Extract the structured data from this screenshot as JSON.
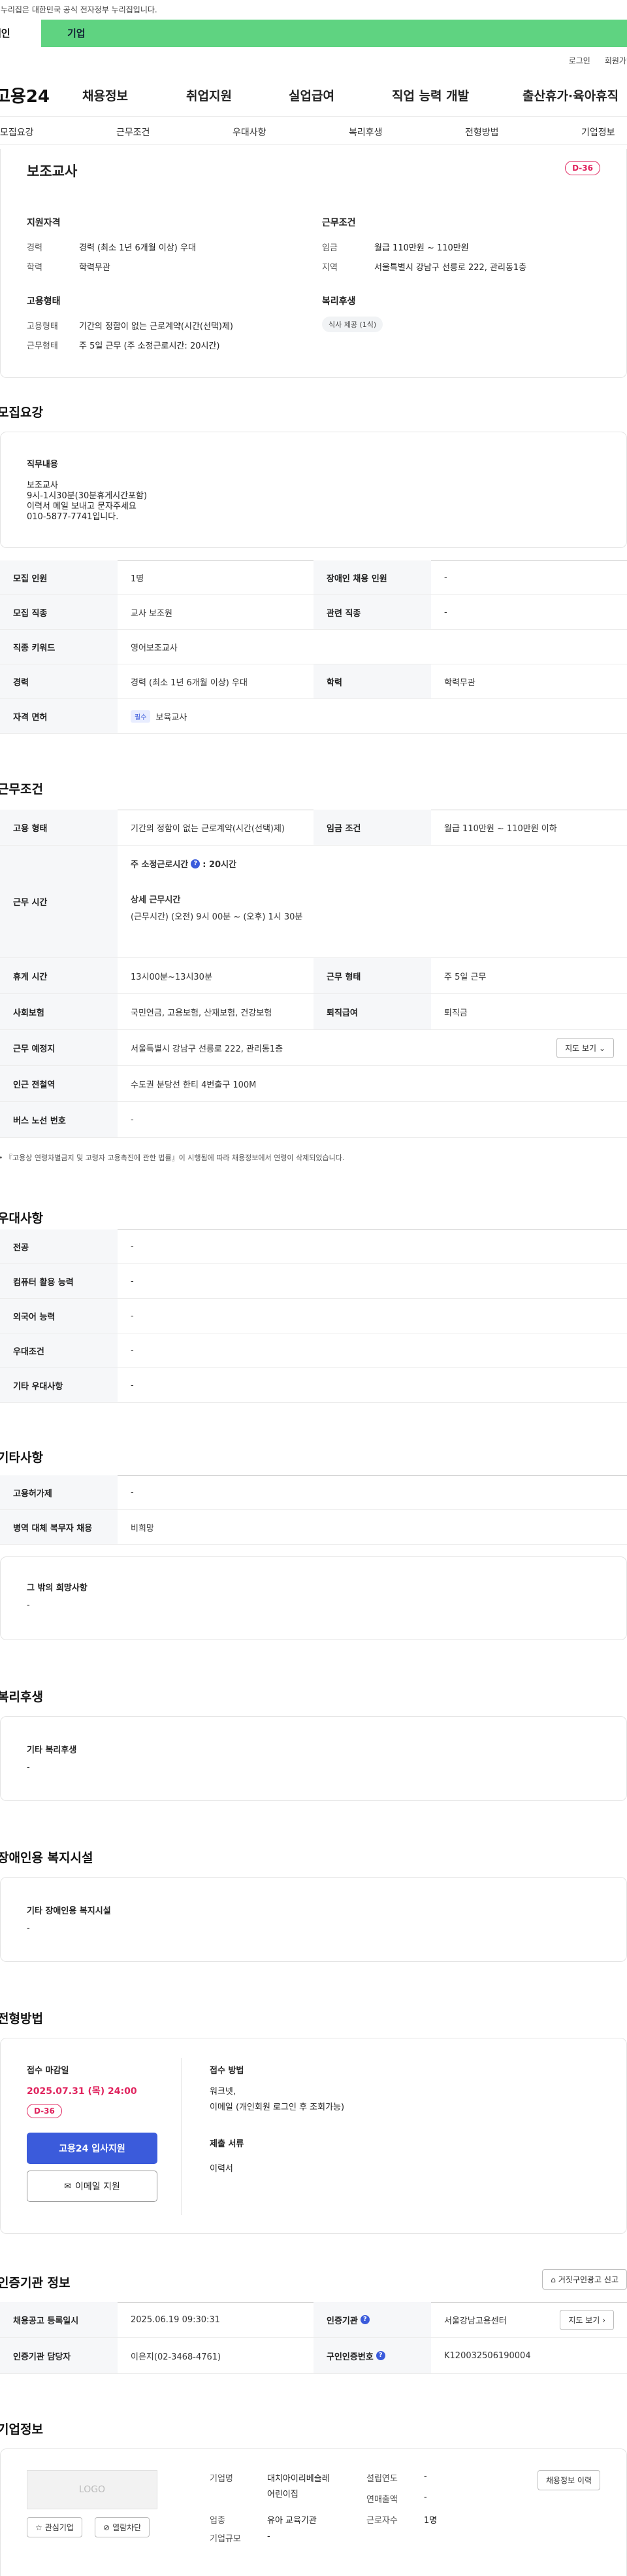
{
  "gov_notice": "이 누리집은 대한민국 공식 전자정부 누리집입니다.",
  "audience": {
    "individual": "개인",
    "corporate": "기업"
  },
  "util": {
    "login": "로그인",
    "signup": "회원가입"
  },
  "gnb": {
    "logo": "고용24",
    "items": [
      "채용정보",
      "취업지원",
      "실업급여",
      "직업 능력 개발",
      "출산휴가·육아휴직"
    ]
  },
  "tabs": [
    "모집요강",
    "근무조건",
    "우대사항",
    "복리후생",
    "전형방법",
    "기업정보"
  ],
  "summary": {
    "title": "보조교사",
    "dday": "D-36",
    "qual_title": "지원자격",
    "career_label": "경력",
    "career_value": "경력 (최소 1년 6개월 이상) 우대",
    "edu_label": "학력",
    "edu_value": "학력무관",
    "cond_title": "근무조건",
    "wage_label": "임금",
    "wage_value": "월급 110만원 ~ 110만원",
    "region_label": "지역",
    "region_value": "서울특별시 강남구 선릉로 222, 관리동1층",
    "emp_title": "고용형태",
    "emp_label": "고용형태",
    "emp_value": "기간의 정함이 없는 근로계약(시간(선택)제)",
    "work_label": "근무형태",
    "work_value": "주 5일 근무 (주 소정근로시간: 20시간)",
    "welfare_title": "복리후생",
    "welfare_chip": "식사 제공 (1식)"
  },
  "recruit": {
    "title": "모집요강",
    "job_title": "직무내용",
    "job_lines": [
      "보조교사",
      "9시-1시30분(30분휴게시간포함)",
      "이력서 메일 보내고 문자주세요",
      "010-5877-7741입니다."
    ],
    "rows": [
      {
        "k1": "모집 인원",
        "v1": "1명",
        "k2": "장애인 채용 인원",
        "v2": "-"
      },
      {
        "k1": "모집 직종",
        "v1": "교사 보조원",
        "k2": "관련 직종",
        "v2": "-"
      },
      {
        "k1": "직종 키워드",
        "v1": "영어보조교사",
        "k2": "",
        "v2": ""
      },
      {
        "k1": "경력",
        "v1": "경력 (최소 1년 6개월 이상) 우대",
        "k2": "학력",
        "v2": "학력무관"
      }
    ],
    "license_label": "자격 면허",
    "license_chip": "필수",
    "license_value": "보육교사"
  },
  "conditions": {
    "title": "근무조건",
    "type_label": "고용 형태",
    "type_value": "기간의 정함이 없는 근로계약(시간(선택)제)",
    "wage_label": "임금 조건",
    "wage_value": "월급 110만원 ~ 110만원 이하",
    "hours_label": "근무 시간",
    "hours_head": "주 소정근로시간",
    "hours_value": ": 20시간",
    "detail_head": "상세 근무시간",
    "detail_value": "(근무시간) (오전) 9시 00분 ~ (오후) 1시 30분",
    "rest_label": "휴게 시간",
    "rest_value": "13시00분~13시30분",
    "form_label": "근무 형태",
    "form_value": "주 5일 근무",
    "ins_label": "사회보험",
    "ins_value": "국민연금, 고용보험, 산재보험, 건강보험",
    "sev_label": "퇴직급여",
    "sev_value": "퇴직금",
    "place_label": "근무 예정지",
    "place_value": "서울특별시 강남구 선릉로 222, 관리동1층",
    "map_btn": "지도 보기",
    "subway_label": "인근 전철역",
    "subway_value": "수도권 분당선 한티 4번출구 100M",
    "bus_label": "버스 노선 번호",
    "bus_value": "-",
    "notice": "『고용상 연령차별금지 및 고령자 고용촉진에 관한 법률』이 시행됨에 따라 채용정보에서 연령이 삭제되었습니다."
  },
  "prefer": {
    "title": "우대사항",
    "rows": [
      {
        "k": "전공",
        "v": "-"
      },
      {
        "k": "컴퓨터 활용 능력",
        "v": "-"
      },
      {
        "k": "외국어 능력",
        "v": "-"
      },
      {
        "k": "우대조건",
        "v": "-"
      },
      {
        "k": "기타 우대사항",
        "v": "-"
      }
    ]
  },
  "etc": {
    "title": "기타사항",
    "rows": [
      {
        "k": "고용허가제",
        "v": "-"
      },
      {
        "k": "병역 대체 복무자 채용",
        "v": "비희망"
      }
    ],
    "other_title": "그 밖의 희망사항",
    "other_value": "-"
  },
  "welfare": {
    "title": "복리후생",
    "box_title": "기타 복리후생",
    "box_value": "-"
  },
  "disability": {
    "title": "장애인용 복지시설",
    "box_title": "기타 장애인용 복지시설",
    "box_value": "-"
  },
  "selection": {
    "title": "전형방법",
    "deadline_label": "접수 마감일",
    "deadline_value": "2025.07.31 (목) 24:00",
    "dday": "D-36",
    "apply_btn": "고용24 입사지원",
    "email_btn": "이메일 지원",
    "method_label": "접수 방법",
    "method_lines": [
      "워크넷,",
      "이메일 (개인회원 로그인 후 조회가능)"
    ],
    "docs_label": "제출 서류",
    "docs_value": "이력서"
  },
  "agency": {
    "title": "인증기관 정보",
    "report_btn": "거짓구인광고 신고",
    "reg_label": "채용공고 등록일시",
    "reg_value": "2025.06.19 09:30:31",
    "org_label": "인증기관",
    "org_value": "서울강남고용센터",
    "map_btn": "지도 보기",
    "staff_label": "인증기관 담당자",
    "staff_value": "이은지(02-3468-4761)",
    "no_label": "구인인증번호",
    "no_value": "K120032506190004"
  },
  "company": {
    "title": "기업정보",
    "logo_text": "LOGO",
    "fav_btn": "관심기업",
    "block_btn": "열람차단",
    "name_label": "기업명",
    "name_value_1": "대치아이리베슬레",
    "name_value_2": "어린이집",
    "industry_label": "업종",
    "industry_value": "유아 교육기관",
    "size_label": "기업규모",
    "size_value": "-",
    "year_label": "설립연도",
    "year_value": "-",
    "sales_label": "연매출액",
    "sales_value": "-",
    "emp_label": "근로자수",
    "emp_value": "1명",
    "history_btn": "채용정보 이력"
  }
}
